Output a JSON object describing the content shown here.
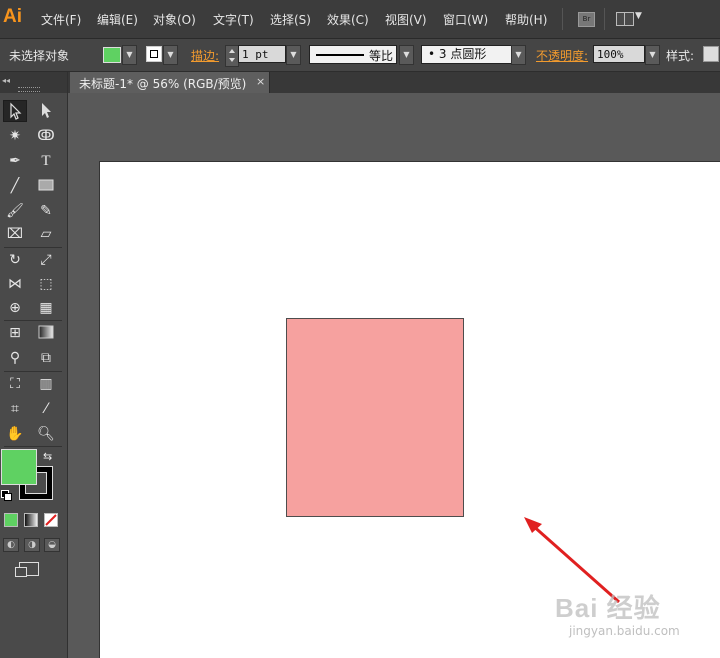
{
  "app": {
    "logo": "Ai"
  },
  "menu": {
    "items": [
      "文件(F)",
      "编辑(E)",
      "对象(O)",
      "文字(T)",
      "选择(S)",
      "效果(C)",
      "视图(V)",
      "窗口(W)",
      "帮助(H)"
    ]
  },
  "bridge_button": "Br",
  "control_bar": {
    "selection_label": "未选择对象",
    "fill_color": "#5fd162",
    "stroke_label": "描边:",
    "stroke_weight": "1 pt",
    "stroke_profile": "等比",
    "brush": "• 3 点圆形",
    "opacity_label": "不透明度:",
    "opacity_value": "100%",
    "style_label": "样式:"
  },
  "document": {
    "tab_title": "未标题-1* @ 56% (RGB/预览)",
    "close": "×"
  },
  "tools": {
    "swap_icon": "⇆"
  },
  "canvas": {
    "rectangle_fill": "#f6a19f",
    "arrow_color": "#e02020"
  },
  "watermark": {
    "main": "Bai 经验",
    "sub": "jingyan.baidu.com"
  }
}
